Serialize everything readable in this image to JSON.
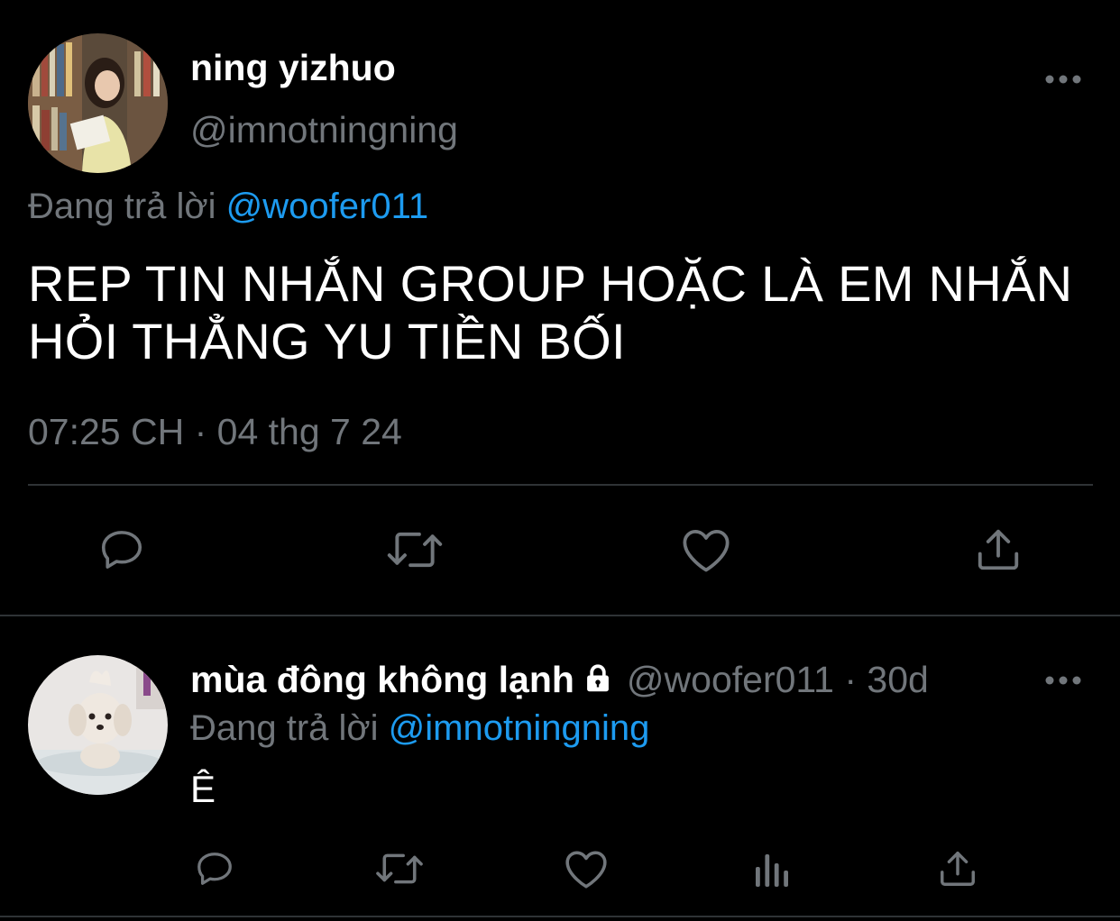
{
  "main_tweet": {
    "display_name": "ning yizhuo",
    "handle": "@imnotningning",
    "reply_prefix": "Đang trả lời",
    "reply_to": "@woofer011",
    "text_line1": "REP TIN NHẮN GROUP HOẶC LÀ EM NHẮN",
    "text_line2": "HỎI THẲNG YU TIỀN BỐI",
    "timestamp": "07:25 CH · 04 thg 7 24",
    "icons": {
      "more": "more-icon",
      "reply": "reply-icon",
      "retweet": "retweet-icon",
      "like": "like-icon",
      "share": "share-icon"
    }
  },
  "reply_tweet": {
    "display_name": "mùa đông không lạnh",
    "handle": "@woofer011",
    "separator": " · ",
    "age": "30d",
    "reply_prefix": "Đang trả lời",
    "reply_to": "@imnotningning",
    "text": "Ê",
    "icons": {
      "lock": "lock-icon",
      "more": "more-icon",
      "reply": "reply-icon",
      "retweet": "retweet-icon",
      "like": "like-icon",
      "views": "analytics-icon",
      "share": "share-icon"
    }
  },
  "colors": {
    "background": "#000000",
    "text": "#ffffff",
    "secondary": "#71767b",
    "link": "#1d9bf0",
    "divider": "#2f3336"
  }
}
